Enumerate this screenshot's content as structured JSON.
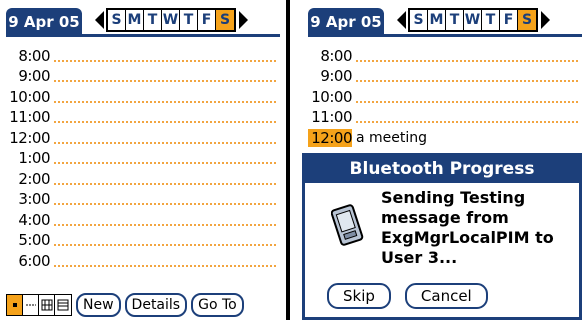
{
  "left": {
    "header": {
      "date": "9 Apr 05",
      "days": [
        "S",
        "M",
        "T",
        "W",
        "T",
        "F",
        "S"
      ],
      "selected_day_index": 6
    },
    "times": [
      "8:00",
      "9:00",
      "10:00",
      "11:00",
      "12:00",
      "1:00",
      "2:00",
      "3:00",
      "4:00",
      "5:00",
      "6:00"
    ],
    "toolbar": {
      "new": "New",
      "details": "Details",
      "goto": "Go To"
    }
  },
  "right": {
    "header": {
      "date": "9 Apr 05",
      "days": [
        "S",
        "M",
        "T",
        "W",
        "T",
        "F",
        "S"
      ],
      "selected_day_index": 6
    },
    "times": [
      "8:00",
      "9:00",
      "10:00",
      "11:00",
      "12:00"
    ],
    "appointment": {
      "time_index": 4,
      "text": "a meeting"
    },
    "dialog": {
      "title": "Bluetooth Progress",
      "message_lines": [
        "Sending Testing",
        "message from",
        "ExgMgrLocalPIM to",
        "User 3..."
      ],
      "skip": "Skip",
      "cancel": "Cancel"
    }
  },
  "colors": {
    "navy": "#1c3f7a",
    "orange": "#f5a21a",
    "dots": "#f2a540"
  }
}
